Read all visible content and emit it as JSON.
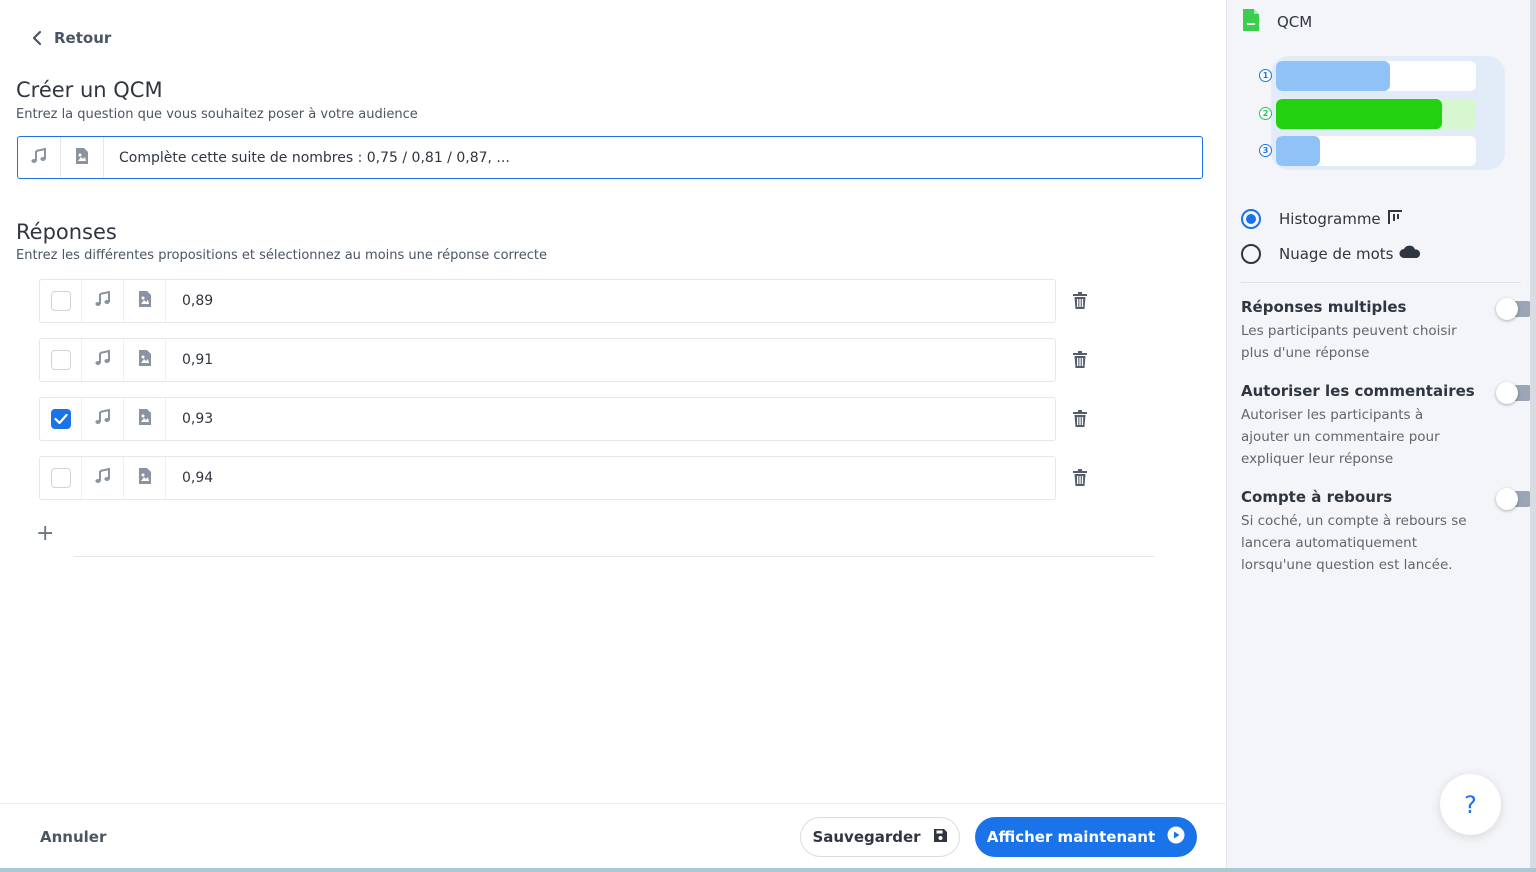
{
  "nav": {
    "back_label": "Retour"
  },
  "question": {
    "title": "Créer un QCM",
    "subtitle": "Entrez la question que vous souhaitez poser à votre audience",
    "value": "Complète cette suite de nombres : 0,75 / 0,81 / 0,87, ..."
  },
  "answers": {
    "title": "Réponses",
    "subtitle": "Entrez les différentes propositions et sélectionnez au moins une réponse correcte",
    "items": [
      {
        "value": "0,89",
        "checked": false
      },
      {
        "value": "0,91",
        "checked": false
      },
      {
        "value": "0,93",
        "checked": true
      },
      {
        "value": "0,94",
        "checked": false
      }
    ],
    "add_label": "+"
  },
  "footer": {
    "cancel_label": "Annuler",
    "save_label": "Sauvegarder",
    "show_label": "Afficher maintenant"
  },
  "panel": {
    "type_label": "QCM",
    "preview": [
      {
        "num": "1",
        "fraction": 0.57,
        "color": "#90c2f7",
        "correct": false
      },
      {
        "num": "2",
        "fraction": 0.83,
        "color": "#22d10f",
        "correct": true
      },
      {
        "num": "3",
        "fraction": 0.22,
        "color": "#90c2f7",
        "correct": false
      }
    ],
    "display_modes": [
      {
        "label": "Histogramme",
        "selected": true,
        "icon": "bar-chart-icon"
      },
      {
        "label": "Nuage de mots",
        "selected": false,
        "icon": "cloud-icon"
      }
    ],
    "options": [
      {
        "title": "Réponses multiples",
        "desc": "Les participants peuvent choisir plus d'une réponse",
        "enabled": false
      },
      {
        "title": "Autoriser les commentaires",
        "desc": "Autoriser les participants à ajouter un commentaire pour expliquer leur réponse",
        "enabled": false
      },
      {
        "title": "Compte à rebours",
        "desc": "Si coché, un compte à rebours se lancera automatiquement lorsqu'une question est lancée.",
        "enabled": false
      }
    ],
    "help_label": "?"
  },
  "colors": {
    "accent": "#1a73e8",
    "correct": "#22d10f",
    "bar": "#90c2f7"
  }
}
